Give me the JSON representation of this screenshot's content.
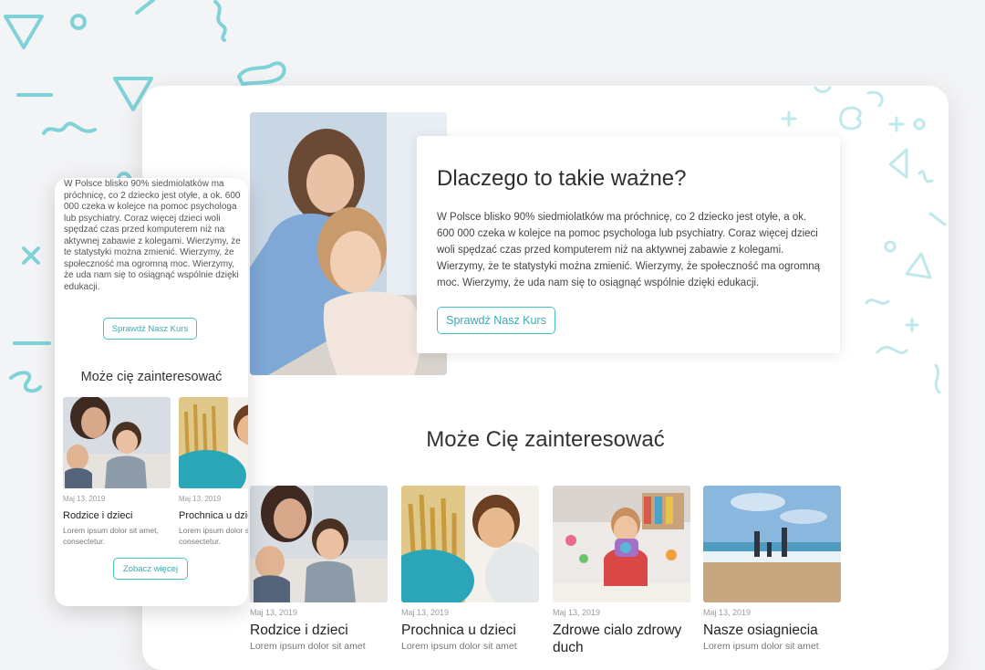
{
  "colors": {
    "accent": "#4bbfc6",
    "background": "#f3f4f6",
    "card": "#ffffff"
  },
  "hero": {
    "title": "Dlaczego to takie ważne?",
    "text": "W Polsce blisko 90% siedmiolatków ma próchnicę, co 2 dziecko jest otyłe, a ok. 600 000 czeka w kolejce na pomoc psychologa lub psychiatry. Coraz więcej dzieci woli spędzać czas przed komputerem niż na aktywnej zabawie z kolegami. Wierzymy, że te statystyki można zmienić. Wierzymy, że społeczność ma ogromną moc. Wierzymy, że uda nam się to osiągnąć wspólnie dzięki edukacji.",
    "button": "Sprawdź Nasz Kurs"
  },
  "section": {
    "title": "Może Cię zainteresować"
  },
  "articles": [
    {
      "date": "Maj 13, 2019",
      "title": "Rodzice i dzieci",
      "desc": "Lorem ipsum dolor sit amet"
    },
    {
      "date": "Maj 13, 2019",
      "title": "Prochnica u dzieci",
      "desc": "Lorem ipsum dolor sit amet"
    },
    {
      "date": "Maj 13, 2019",
      "title": "Zdrowe cialo zdrowy duch",
      "desc": ""
    },
    {
      "date": "Maj 13, 2019",
      "title": "Nasze osiagniecia",
      "desc": "Lorem ipsum dolor sit amet"
    }
  ],
  "mobile": {
    "text": "W Polsce blisko 90% siedmiolatków ma próchnicę, co 2 dziecko jest otyłe, a ok. 600 000 czeka w kolejce na pomoc psychologa lub psychiatry. Coraz więcej dzieci woli spędzać czas przed komputerem niż na aktywnej zabawie z kolegami. Wierzymy, że te statystyki można zmienić. Wierzymy, że społeczność ma ogromną moc. Wierzymy, że uda nam się to osiągnąć wspólnie dzięki edukacji.",
    "button": "Sprawdź Nasz Kurs",
    "section_title": "Może cię zainteresować",
    "articles": [
      {
        "date": "Maj 13, 2019",
        "title": "Rodzice i dzieci",
        "desc": "Lorem ipsum dolor sit amet, consectetur."
      },
      {
        "date": "Maj 13, 2019",
        "title": "Prochnica u dzieci",
        "desc": "Lorem ipsum dolor sit amet, consectetur."
      }
    ],
    "more_button": "Zobacz więcej"
  }
}
